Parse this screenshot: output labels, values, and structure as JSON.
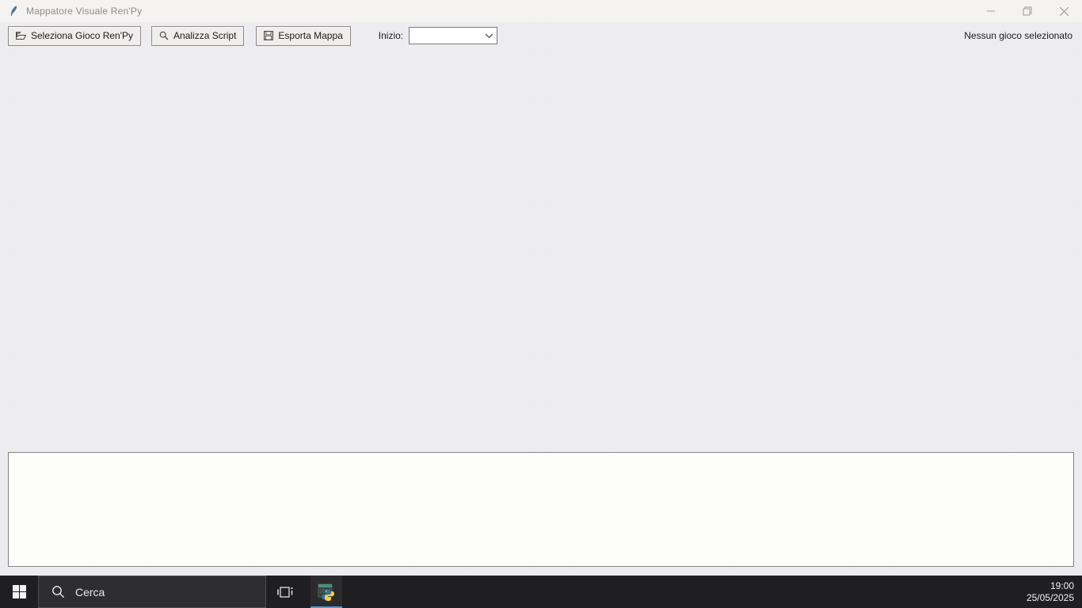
{
  "window": {
    "title": "Mappatore Visuale Ren'Py",
    "app_icon": "python-feather-icon",
    "controls": [
      {
        "name": "minimize",
        "icon": "minimize-icon"
      },
      {
        "name": "maximize",
        "icon": "maximize-icon"
      },
      {
        "name": "close",
        "icon": "close-icon"
      }
    ]
  },
  "toolbar": {
    "buttons": [
      {
        "label": "Seleziona Gioco Ren'Py",
        "icon": "folder-open-icon"
      },
      {
        "label": "Analizza Script",
        "icon": "magnifier-icon"
      },
      {
        "label": "Esporta Mappa",
        "icon": "save-icon"
      }
    ],
    "start_label": "Inizio:",
    "start_combobox": {
      "value": "",
      "icon": "chevron-down-icon"
    },
    "status": "Nessun gioco selezionato"
  },
  "log_panel": {
    "content": ""
  },
  "taskbar": {
    "start_icon": "windows-start-icon",
    "search": {
      "placeholder": "Cerca",
      "icon": "search-icon"
    },
    "task_view_icon": "task-view-icon",
    "pinned_app": {
      "icon": "python-app-icon",
      "active": true
    },
    "clock": {
      "time": "19:00",
      "date": "25/05/2025"
    }
  },
  "colors": {
    "titlebar_bg": "#f5f4f2",
    "client_bg": "#edecee",
    "button_bg": "#efeeec",
    "button_border": "#8e8e8e",
    "log_panel_bg": "#fdfdfc",
    "log_panel_border": "#848484",
    "taskbar_bg": "#1d1d20",
    "searchbox_bg": "#2e2d32",
    "active_app_underline": "#4f9bd5",
    "title_text": "#8d8d8d",
    "status_text": "#1b1b1b"
  }
}
